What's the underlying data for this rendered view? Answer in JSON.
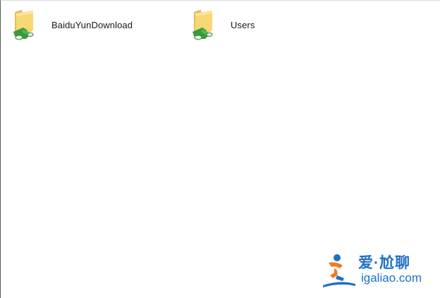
{
  "files": [
    {
      "name": "BaiduYunDownload",
      "icon": "shared-folder-icon"
    },
    {
      "name": "Users",
      "icon": "shared-folder-icon"
    }
  ],
  "watermark": {
    "title": "爱·尬聊",
    "url": "igaliao.com",
    "colors": {
      "blue": "#1f6fc4",
      "orange": "#f07b1e"
    }
  }
}
